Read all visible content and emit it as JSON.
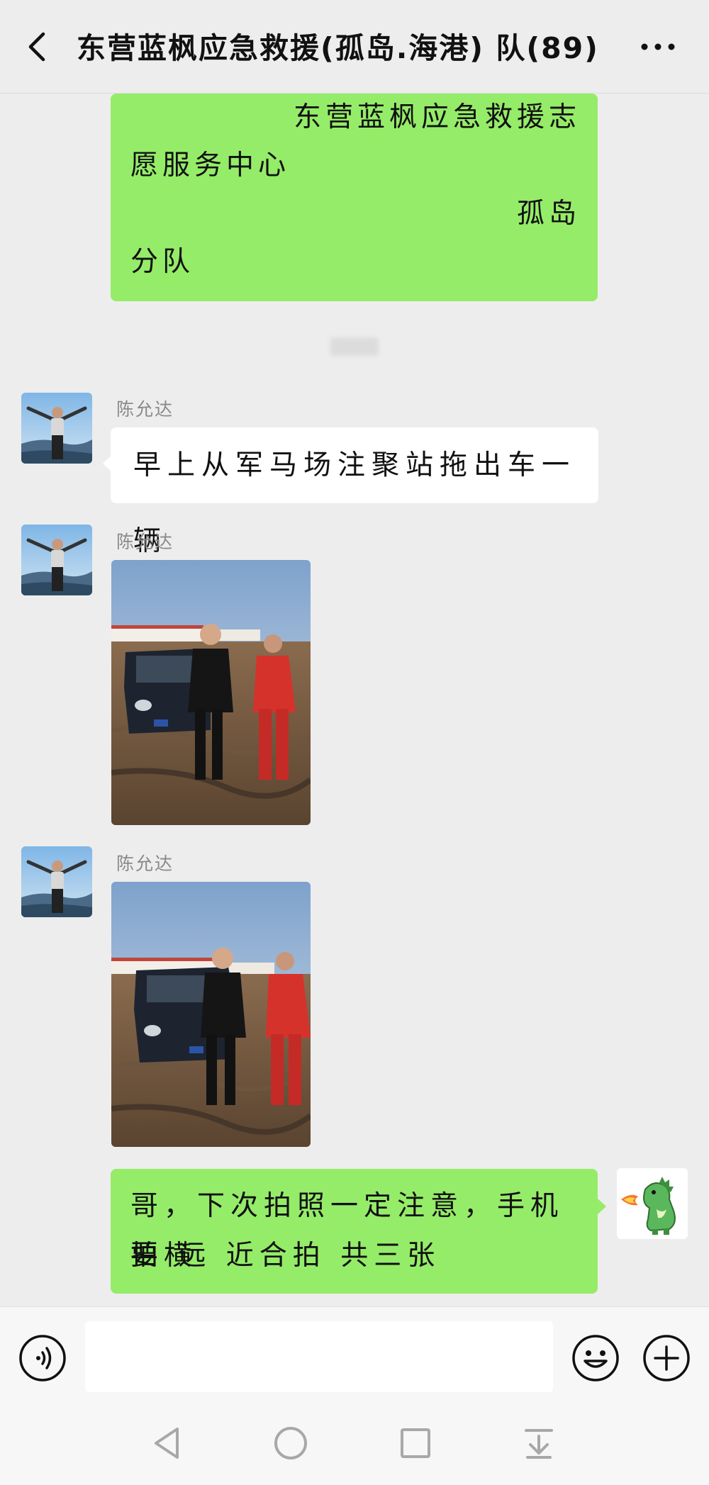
{
  "header": {
    "title": "东营蓝枫应急救援(孤岛.海港) 队(89)",
    "back_icon": "chevron-left-icon",
    "more_icon": "more-dots-icon"
  },
  "messages": {
    "top": {
      "lines": [
        "东营蓝枫应急救援志",
        "愿服务中心",
        "孤岛",
        "分队"
      ]
    },
    "m1": {
      "sender": "陈允达",
      "text": "早上从军马场注聚站拖出车一辆"
    },
    "m2": {
      "sender": "陈允达"
    },
    "m3": {
      "sender": "陈允达"
    },
    "bottom": {
      "lines": [
        "哥，下次拍照一定注意，手机要横",
        "拍 远 近合拍 共三张"
      ]
    }
  },
  "input": {
    "voice_icon": "voice-icon",
    "emoji_icon": "emoji-icon",
    "plus_icon": "plus-icon"
  },
  "nav": {
    "back_icon": "nav-back-icon",
    "home_icon": "nav-home-icon",
    "recents_icon": "nav-recents-icon",
    "dropdown_icon": "nav-notifications-icon"
  },
  "colors": {
    "my_bubble": "#95ec69",
    "other_bubble": "#ffffff",
    "background": "#ededed"
  }
}
